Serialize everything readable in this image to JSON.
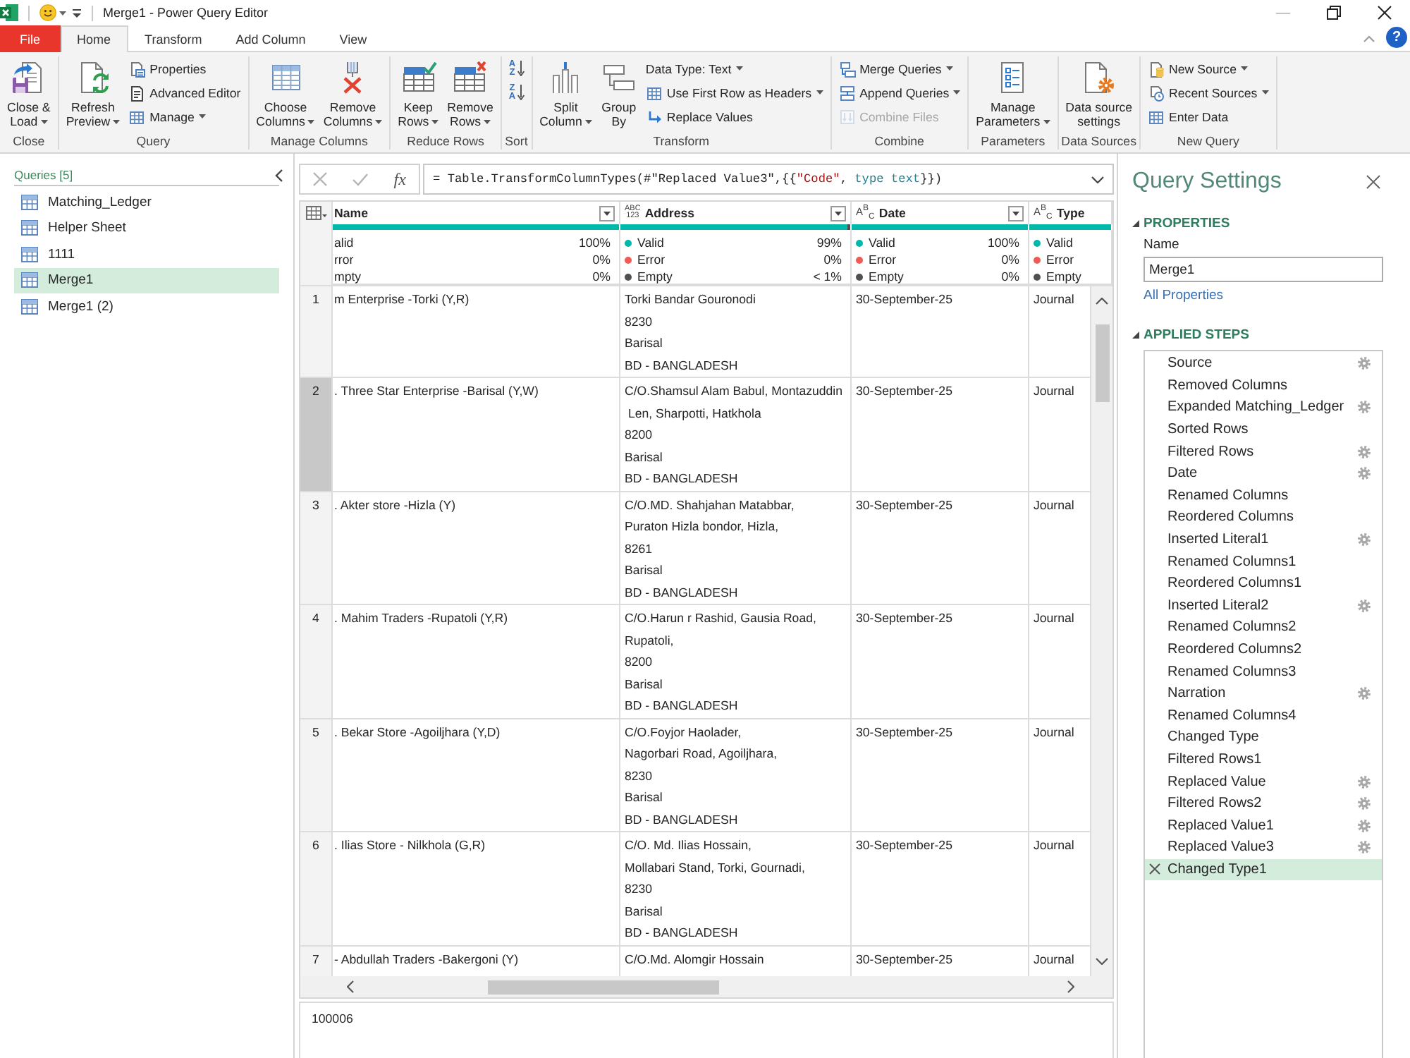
{
  "window": {
    "title": "Merge1 - Power Query Editor"
  },
  "tabs": [
    {
      "label": "File",
      "kind": "file",
      "selected": false
    },
    {
      "label": "Home",
      "kind": "tab",
      "selected": true
    },
    {
      "label": "Transform",
      "kind": "tab",
      "selected": false
    },
    {
      "label": "Add Column",
      "kind": "tab",
      "selected": false
    },
    {
      "label": "View",
      "kind": "tab",
      "selected": false
    }
  ],
  "help": {
    "label": "?"
  },
  "ribbon": {
    "groups": [
      {
        "label": "Close",
        "items": [
          {
            "kind": "large",
            "lines": [
              "Close &",
              "Load"
            ],
            "dropdown": true
          }
        ]
      },
      {
        "label": "Query",
        "items": [
          {
            "kind": "large",
            "lines": [
              "Refresh",
              "Preview"
            ],
            "dropdown": true
          },
          {
            "kind": "stack",
            "buttons": [
              {
                "label": "Properties",
                "dropdown": false,
                "disabled": false
              },
              {
                "label": "Advanced Editor",
                "dropdown": false,
                "disabled": false
              },
              {
                "label": "Manage",
                "dropdown": true,
                "disabled": false
              }
            ]
          }
        ]
      },
      {
        "label": "Manage Columns",
        "items": [
          {
            "kind": "large",
            "lines": [
              "Choose",
              "Columns"
            ],
            "dropdown": true
          },
          {
            "kind": "large",
            "lines": [
              "Remove",
              "Columns"
            ],
            "dropdown": true
          }
        ]
      },
      {
        "label": "Reduce Rows",
        "items": [
          {
            "kind": "large",
            "lines": [
              "Keep",
              "Rows"
            ],
            "dropdown": true
          },
          {
            "kind": "large",
            "lines": [
              "Remove",
              "Rows"
            ],
            "dropdown": true
          }
        ]
      },
      {
        "label": "Sort",
        "items": [
          {
            "kind": "sort",
            "buttons": [
              {
                "glyphs": [
                  "A",
                  "Z"
                ]
              },
              {
                "glyphs": [
                  "Z",
                  "A"
                ]
              }
            ]
          }
        ]
      },
      {
        "label": "Transform",
        "items": [
          {
            "kind": "large",
            "lines": [
              "Split",
              "Column"
            ],
            "dropdown": true
          },
          {
            "kind": "large",
            "lines": [
              "Group",
              "By"
            ],
            "dropdown": false
          },
          {
            "kind": "stack",
            "buttons": [
              {
                "label": "Data Type: Text",
                "dropdown": true,
                "disabled": false
              },
              {
                "label": "Use First Row as Headers",
                "dropdown": true,
                "disabled": false
              },
              {
                "label": "Replace Values",
                "dropdown": false,
                "disabled": false
              }
            ]
          }
        ]
      },
      {
        "label": "Combine",
        "items": [
          {
            "kind": "stack",
            "buttons": [
              {
                "label": "Merge Queries",
                "dropdown": true,
                "disabled": false
              },
              {
                "label": "Append Queries",
                "dropdown": true,
                "disabled": false
              },
              {
                "label": "Combine Files",
                "dropdown": false,
                "disabled": true
              }
            ]
          }
        ]
      },
      {
        "label": "Parameters",
        "items": [
          {
            "kind": "large",
            "lines": [
              "Manage",
              "Parameters"
            ],
            "dropdown": true
          }
        ]
      },
      {
        "label": "Data Sources",
        "items": [
          {
            "kind": "large",
            "lines": [
              "Data source",
              "settings"
            ],
            "dropdown": false
          }
        ]
      },
      {
        "label": "New Query",
        "items": [
          {
            "kind": "stack",
            "buttons": [
              {
                "label": "New Source",
                "dropdown": true,
                "disabled": false
              },
              {
                "label": "Recent Sources",
                "dropdown": true,
                "disabled": false
              },
              {
                "label": "Enter Data",
                "dropdown": false,
                "disabled": false
              }
            ]
          }
        ]
      }
    ]
  },
  "queries": {
    "header": "Queries [5]",
    "items": [
      {
        "label": "Matching_Ledger",
        "selected": false
      },
      {
        "label": "Helper Sheet",
        "selected": false
      },
      {
        "label": "1111",
        "selected": false
      },
      {
        "label": "Merge1",
        "selected": true
      },
      {
        "label": "Merge1 (2)",
        "selected": false
      }
    ]
  },
  "formula_bar": {
    "fx": "fx",
    "segments": [
      {
        "kind": "plain",
        "text": "= Table.TransformColumnTypes(#\"Replaced Value3\",{{"
      },
      {
        "kind": "string",
        "text": "\"Code\""
      },
      {
        "kind": "plain",
        "text": ", "
      },
      {
        "kind": "keyword",
        "text": "type text"
      },
      {
        "kind": "plain",
        "text": "}})"
      }
    ]
  },
  "table": {
    "columns": [
      {
        "header": "Name",
        "filter": true,
        "level": 1,
        "quality": [
          {
            "label": "alid",
            "value": "100%"
          },
          {
            "label": "rror",
            "value": "0%"
          },
          {
            "label": "mpty",
            "value": "0%"
          }
        ]
      },
      {
        "header": "Address",
        "type_icon": {
          "kind": "any",
          "lines": [
            "ABC",
            "123"
          ]
        },
        "filter": true,
        "level": 0.99,
        "quality": [
          {
            "label": "Valid",
            "value": "99%",
            "color": "#01b8aa"
          },
          {
            "label": "Error",
            "value": "0%",
            "color": "#f25a55"
          },
          {
            "label": "Empty",
            "value": "< 1%",
            "color": "#505050"
          }
        ]
      },
      {
        "header": "Date",
        "type_icon": {
          "kind": "text",
          "text": "A$^{B}$$_{C}$"
        },
        "filter": true,
        "level": 1,
        "quality": [
          {
            "label": "Valid",
            "value": "100%",
            "color": "#01b8aa"
          },
          {
            "label": "Error",
            "value": "0%",
            "color": "#f25a55"
          },
          {
            "label": "Empty",
            "value": "0%",
            "color": "#505050"
          }
        ]
      },
      {
        "header": "Type",
        "type_icon": {
          "kind": "text",
          "text": "A$^{B}$$_{C}$"
        },
        "level": 1,
        "quality": [
          {
            "label": "Valid",
            "color": "#01b8aa"
          },
          {
            "label": "Error",
            "color": "#f25a55"
          },
          {
            "label": "Empty",
            "color": "#505050"
          }
        ]
      }
    ],
    "rows": [
      {
        "number": "1",
        "selected": false,
        "cells": [
          "m Enterprise -Torki (Y,R)",
          "Torki Bandar Gouronodi\n8230\nBarisal\nBD - BANGLADESH",
          "30-September-25",
          "Journal"
        ]
      },
      {
        "number": "2",
        "selected": true,
        "cells": [
          ". Three Star Enterprise -Barisal (Y,W)",
          "C/O.Shamsul Alam Babul, Montazuddin\n Len, Sharpotti, Hatkhola\n8200\nBarisal\nBD - BANGLADESH",
          "30-September-25",
          "Journal"
        ]
      },
      {
        "number": "3",
        "selected": false,
        "cells": [
          ". Akter store -Hizla (Y)",
          "C/O.MD. Shahjahan Matabbar,\nPuraton Hizla bondor, Hizla,\n8261\nBarisal\nBD - BANGLADESH",
          "30-September-25",
          "Journal"
        ]
      },
      {
        "number": "4",
        "selected": false,
        "cells": [
          ". Mahim Traders -Rupatoli (Y,R)",
          "C/O.Harun r Rashid, Gausia Road,\nRupatoli,\n8200\nBarisal\nBD - BANGLADESH",
          "30-September-25",
          "Journal"
        ]
      },
      {
        "number": "5",
        "selected": false,
        "cells": [
          ". Bekar Store -Agoiljhara (Y,D)",
          "C/O.Foyjor Haolader,\nNagorbari Road, Agoiljhara,\n8230\nBarisal\nBD - BANGLADESH",
          "30-September-25",
          "Journal"
        ]
      },
      {
        "number": "6",
        "selected": false,
        "cells": [
          ". Ilias Store - Nilkhola (G,R)",
          "C/O. Md. Ilias Hossain,\nMollabari Stand, Torki, Gournadi,\n8230\nBarisal\nBD - BANGLADESH",
          "30-September-25",
          "Journal"
        ]
      },
      {
        "number": "7",
        "selected": false,
        "cells": [
          "- Abdullah Traders -Bakergoni (Y)",
          "C/O.Md. Alomgir Hossain",
          "30-September-25",
          "Journal"
        ]
      }
    ]
  },
  "value_preview": "100006",
  "query_settings": {
    "title": "Query Settings",
    "properties": {
      "heading": "PROPERTIES",
      "expanded": true,
      "name_label": "Name",
      "name_value": "Merge1",
      "link": "All Properties"
    },
    "applied_steps": {
      "heading": "APPLIED STEPS",
      "expanded": true,
      "steps": [
        {
          "label": "Source",
          "settings": true,
          "selected": false
        },
        {
          "label": "Removed Columns",
          "settings": false,
          "selected": false
        },
        {
          "label": "Expanded Matching_Ledger",
          "settings": true,
          "selected": false
        },
        {
          "label": "Sorted Rows",
          "settings": false,
          "selected": false
        },
        {
          "label": "Filtered Rows",
          "settings": true,
          "selected": false
        },
        {
          "label": "Date",
          "settings": true,
          "selected": false
        },
        {
          "label": "Renamed Columns",
          "settings": false,
          "selected": false
        },
        {
          "label": "Reordered Columns",
          "settings": false,
          "selected": false
        },
        {
          "label": "Inserted Literal1",
          "settings": true,
          "selected": false
        },
        {
          "label": "Renamed Columns1",
          "settings": false,
          "selected": false
        },
        {
          "label": "Reordered Columns1",
          "settings": false,
          "selected": false
        },
        {
          "label": "Inserted Literal2",
          "settings": true,
          "selected": false
        },
        {
          "label": "Renamed Columns2",
          "settings": false,
          "selected": false
        },
        {
          "label": "Reordered Columns2",
          "settings": false,
          "selected": false
        },
        {
          "label": "Renamed Columns3",
          "settings": false,
          "selected": false
        },
        {
          "label": "Narration",
          "settings": true,
          "selected": false
        },
        {
          "label": "Renamed Columns4",
          "settings": false,
          "selected": false
        },
        {
          "label": "Changed Type",
          "settings": false,
          "selected": false
        },
        {
          "label": "Filtered Rows1",
          "settings": false,
          "selected": false
        },
        {
          "label": "Replaced Value",
          "settings": true,
          "selected": false
        },
        {
          "label": "Filtered Rows2",
          "settings": true,
          "selected": false
        },
        {
          "label": "Replaced Value1",
          "settings": true,
          "selected": false
        },
        {
          "label": "Replaced Value3",
          "settings": true,
          "selected": false
        },
        {
          "label": "Changed Type1",
          "settings": false,
          "selected": true
        }
      ]
    }
  }
}
